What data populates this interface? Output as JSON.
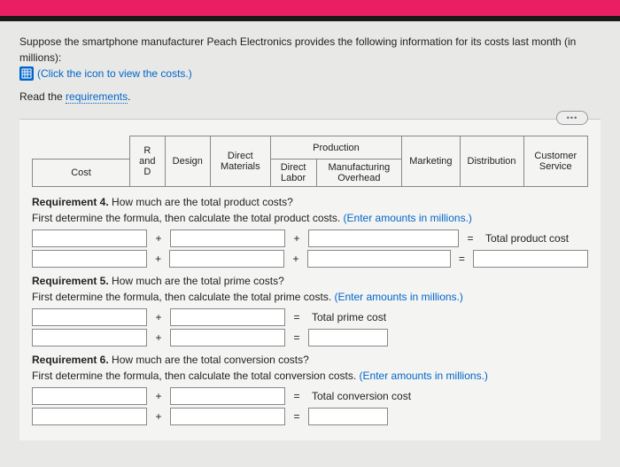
{
  "intro": {
    "line1_prefix": "Suppose the smartphone manufacturer Peach Electronics provides the following information for its costs last month (in millions):",
    "icon_link_text": "(Click the icon to view the costs.)",
    "read_prefix": "Read the ",
    "requirements_link": "requirements"
  },
  "more_btn": "•••",
  "headers": {
    "cost": "Cost",
    "rd": "R and D",
    "design": "Design",
    "dm": "Direct Materials",
    "production": "Production",
    "dl": "Direct Labor",
    "moh": "Manufacturing Overhead",
    "marketing": "Marketing",
    "distribution": "Distribution",
    "cs": "Customer Service"
  },
  "req4": {
    "title": "Requirement 4.",
    "q": " How much are the total product costs?",
    "instr_prefix": "First determine the formula, then calculate the total product costs. ",
    "instr_hint": "(Enter amounts in millions.)",
    "result_label": "Total product cost"
  },
  "req5": {
    "title": "Requirement 5.",
    "q": " How much are the total prime costs?",
    "instr_prefix": "First determine the formula, then calculate the total prime costs. ",
    "instr_hint": "(Enter amounts in millions.)",
    "result_label": "Total prime cost"
  },
  "req6": {
    "title": "Requirement 6.",
    "q": " How much are the total conversion costs?",
    "instr_prefix": "First determine the formula, then calculate the total conversion costs. ",
    "instr_hint": "(Enter amounts in millions.)",
    "result_label": "Total conversion cost"
  },
  "ops": {
    "plus": "+",
    "eq": "="
  }
}
